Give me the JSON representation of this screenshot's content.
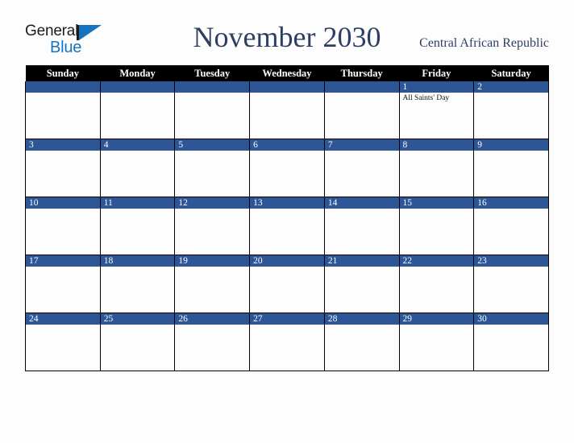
{
  "brand": {
    "name_top": "General",
    "name_bottom": "Blue",
    "mark_icon": "blue-triangle-icon",
    "color_dark": "#1b1b1b",
    "color_blue": "#1574bd"
  },
  "header": {
    "title": "November 2030",
    "country": "Central African Republic",
    "title_color": "#2c3f63"
  },
  "calendar": {
    "month": "November",
    "year": "2030",
    "accent_color": "#2e5596",
    "header_bg": "#000000",
    "header_text_color": "#ffffff",
    "cell_bg": "#fdfdfd",
    "weekday_headers": [
      "Sunday",
      "Monday",
      "Tuesday",
      "Wednesday",
      "Thursday",
      "Friday",
      "Saturday"
    ],
    "weeks": [
      [
        {
          "day": "",
          "events": []
        },
        {
          "day": "",
          "events": []
        },
        {
          "day": "",
          "events": []
        },
        {
          "day": "",
          "events": []
        },
        {
          "day": "",
          "events": []
        },
        {
          "day": "1",
          "events": [
            "All Saints' Day"
          ]
        },
        {
          "day": "2",
          "events": []
        }
      ],
      [
        {
          "day": "3",
          "events": []
        },
        {
          "day": "4",
          "events": []
        },
        {
          "day": "5",
          "events": []
        },
        {
          "day": "6",
          "events": []
        },
        {
          "day": "7",
          "events": []
        },
        {
          "day": "8",
          "events": []
        },
        {
          "day": "9",
          "events": []
        }
      ],
      [
        {
          "day": "10",
          "events": []
        },
        {
          "day": "11",
          "events": []
        },
        {
          "day": "12",
          "events": []
        },
        {
          "day": "13",
          "events": []
        },
        {
          "day": "14",
          "events": []
        },
        {
          "day": "15",
          "events": []
        },
        {
          "day": "16",
          "events": []
        }
      ],
      [
        {
          "day": "17",
          "events": []
        },
        {
          "day": "18",
          "events": []
        },
        {
          "day": "19",
          "events": []
        },
        {
          "day": "20",
          "events": []
        },
        {
          "day": "21",
          "events": []
        },
        {
          "day": "22",
          "events": []
        },
        {
          "day": "23",
          "events": []
        }
      ],
      [
        {
          "day": "24",
          "events": []
        },
        {
          "day": "25",
          "events": []
        },
        {
          "day": "26",
          "events": []
        },
        {
          "day": "27",
          "events": []
        },
        {
          "day": "28",
          "events": []
        },
        {
          "day": "29",
          "events": []
        },
        {
          "day": "30",
          "events": []
        }
      ]
    ]
  }
}
